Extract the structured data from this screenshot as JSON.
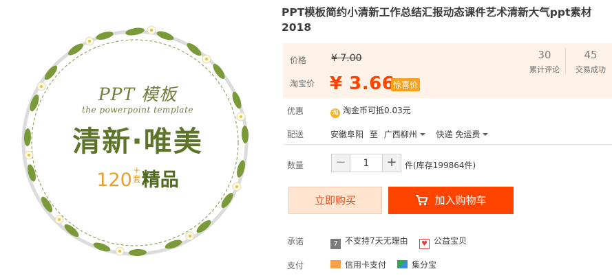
{
  "product_image": {
    "title": "PPT 模板",
    "subtitle": "the powerpoint template",
    "main_text": "清新·唯美",
    "count_number": "120",
    "count_plus": "+",
    "count_unit": "套",
    "count_label": "精品"
  },
  "product": {
    "title": "PPT模板简约小清新工作总结汇报动态课件艺术清新大气ppt素材2018"
  },
  "price": {
    "label": "价格",
    "original": "¥ 7.00",
    "taobao_label": "淘宝价",
    "current": "¥ 3.66",
    "promo_tag": "惊喜价"
  },
  "stats": [
    {
      "value": "30",
      "label": "累计评论"
    },
    {
      "value": "45",
      "label": "交易成功"
    }
  ],
  "discount": {
    "label": "优惠",
    "icon_char": "淘",
    "text": "淘金币可抵0.03元"
  },
  "shipping": {
    "label": "配送",
    "from": "安徽阜阳",
    "to_word": "至",
    "to": "广西柳州",
    "method": "快递 免运费"
  },
  "quantity": {
    "label": "数量",
    "value": "1",
    "minus": "−",
    "plus": "+",
    "stock_text": "件(库存199864件)"
  },
  "actions": {
    "buy_now": "立即购买",
    "add_cart": "加入购物车"
  },
  "promise": {
    "label": "承诺",
    "items": [
      {
        "icon_char": "7",
        "text": "不支持7天无理由"
      },
      {
        "icon_char": "♥",
        "text": "公益宝贝"
      }
    ]
  },
  "payment": {
    "label": "支付",
    "items": [
      "信用卡支付",
      "集分宝"
    ]
  },
  "colors": {
    "accent": "#ff4400",
    "price_bg": "#fff2e8",
    "promo": "#f8a020",
    "leaf": "#6d8a2e"
  }
}
